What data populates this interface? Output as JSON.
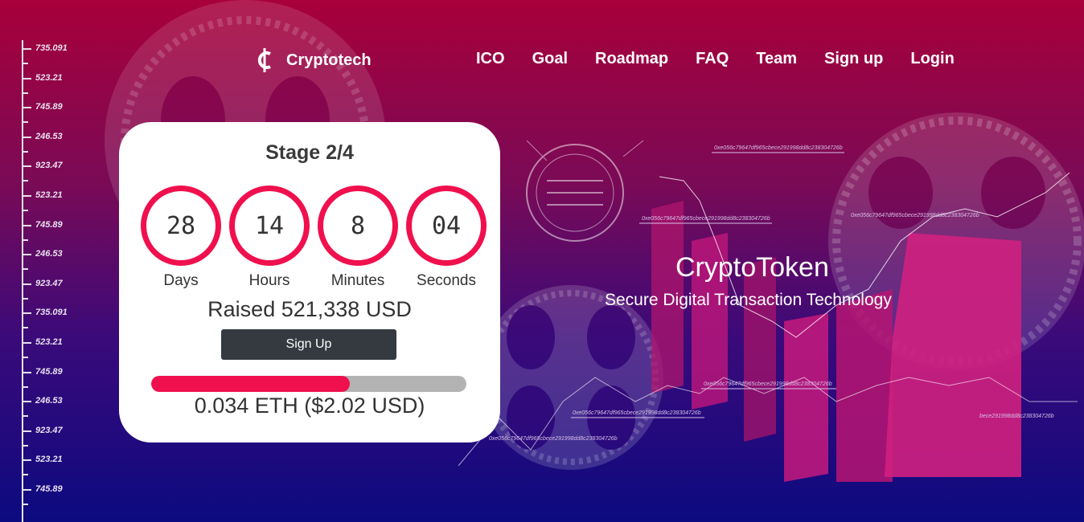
{
  "ruler": {
    "labels": [
      "735.091",
      "523.21",
      "745.89",
      "246.53",
      "923.47",
      "523.21",
      "745.89",
      "246.53",
      "923.47",
      "735.091",
      "523.21",
      "745.89",
      "246.53",
      "923.47",
      "523.21",
      "745.89"
    ]
  },
  "hash_labels": {
    "h1": "0xe056c79647df965cbece291998dd8c238304726b",
    "h2": "0xe056c79647df965cbece291998dd8c238304726b",
    "h3": "0xe056c79647df965cbece291998dd8c238304726b",
    "h4": "0xe056c79647df965cbece291998dd8c238304726b",
    "h5": "0xe056c79647df965cbece291998dd8c238304726b",
    "h6": "0xe056c79647df965cbece291998dd8c238304726b",
    "h7": "bece291998dd8c238304726b"
  },
  "brand": {
    "name": "Cryptotech",
    "icon": "cedi-coin-icon"
  },
  "nav": {
    "items": [
      "ICO",
      "Goal",
      "Roadmap",
      "FAQ",
      "Team",
      "Sign up",
      "Login"
    ]
  },
  "countdown": {
    "stage": "Stage 2/4",
    "units": [
      {
        "value": "28",
        "label": "Days"
      },
      {
        "value": "14",
        "label": "Hours"
      },
      {
        "value": "8",
        "label": "Minutes"
      },
      {
        "value": "04",
        "label": "Seconds"
      }
    ],
    "raised": "Raised 521,338 USD",
    "signup_label": "Sign Up",
    "progress_fraction": 0.63,
    "price": "0.034 ETH ($2.02 USD)"
  },
  "hero": {
    "title": "CryptoToken",
    "subtitle": "Secure Digital Transaction Technology"
  },
  "colors": {
    "accent": "#f0104e",
    "button": "#343a40",
    "bg_top": "#a8003a",
    "bg_bottom": "#0c0a80"
  }
}
